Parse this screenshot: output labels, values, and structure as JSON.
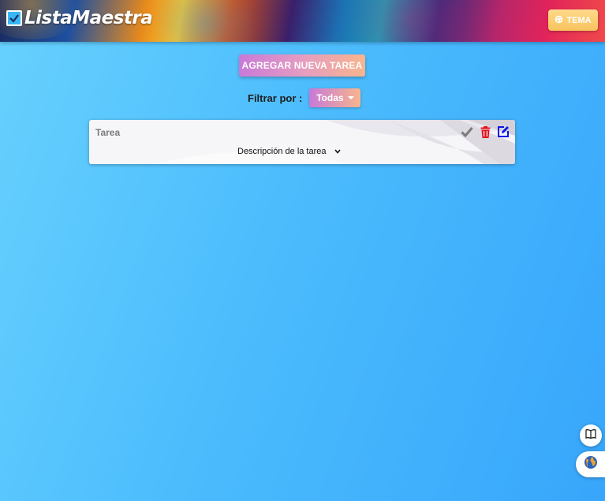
{
  "app": {
    "title": "ListaMaestra"
  },
  "header": {
    "theme_label": "TEMA"
  },
  "toolbar": {
    "add_task_label": "AGREGAR NUEVA TAREA"
  },
  "filter": {
    "label": "Filtrar por :",
    "selected": "Todas"
  },
  "tasks": [
    {
      "title": "Tarea",
      "description": "Descripción de la tarea"
    }
  ],
  "colors": {
    "accent_gradient_start": "#c87ad8",
    "accent_gradient_end": "#f7b58e",
    "background": "#4cbcfd",
    "delete": "#e3101b",
    "edit": "#0b17e6",
    "complete": "#7a7a7a"
  },
  "icons": {
    "brand": "checkbox-icon",
    "theme": "palette-icon",
    "complete": "check-icon",
    "delete": "trash-icon",
    "edit": "edit-icon",
    "expand": "chevron-down-icon",
    "guide": "book-icon",
    "locale": "globe-icon"
  }
}
